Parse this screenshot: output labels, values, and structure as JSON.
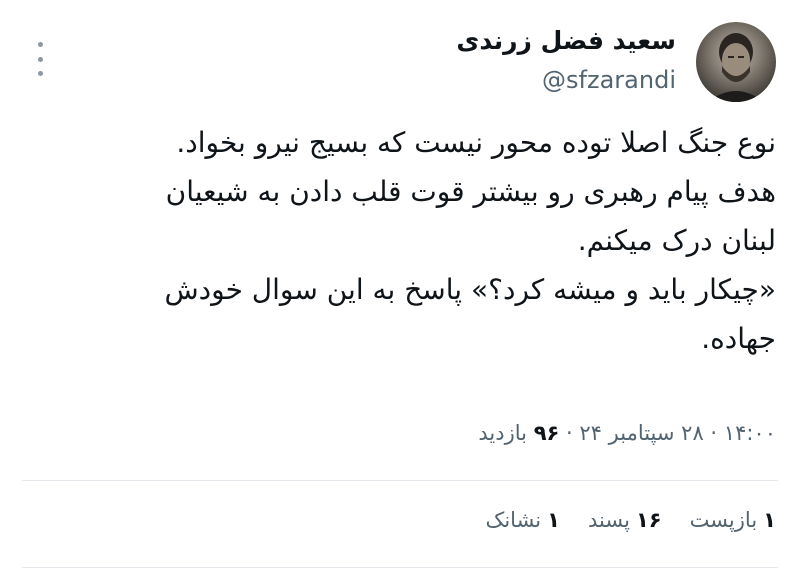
{
  "author": {
    "name": "سعید فضل زرندی",
    "handle": "@sfzarandi"
  },
  "tweet": {
    "lines": [
      "نوع جنگ اصلا توده محور نیست که بسیج نیرو بخواد.",
      "هدف پیام رهبری رو بیشتر قوت قلب دادن به شیعیان",
      "لبنان درک میکنم.",
      "«چیکار باید و میشه کرد؟» پاسخ به این سوال خودش",
      "جهاده."
    ]
  },
  "meta": {
    "time": "۱۴:۰۰",
    "date": "۲۸ سپتامبر ۲۴",
    "views_count": "۹۶",
    "views_label": "بازدید",
    "separator": "·"
  },
  "stats": {
    "reposts_count": "۱",
    "reposts_label": "بازپست",
    "likes_count": "۱۶",
    "likes_label": "پسند",
    "bookmarks_count": "۱",
    "bookmarks_label": "نشانک"
  }
}
